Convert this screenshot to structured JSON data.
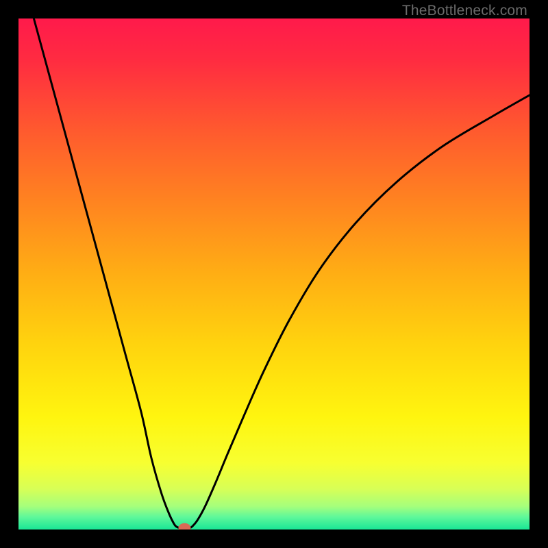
{
  "watermark": "TheBottleneck.com",
  "chart_data": {
    "type": "line",
    "title": "",
    "xlabel": "",
    "ylabel": "",
    "xlim": [
      0,
      100
    ],
    "ylim": [
      0,
      100
    ],
    "grid": false,
    "legend": false,
    "gradient_stops": [
      {
        "pos": 0.0,
        "color": "#ff1a4b"
      },
      {
        "pos": 0.08,
        "color": "#ff2b41"
      },
      {
        "pos": 0.22,
        "color": "#ff5a2e"
      },
      {
        "pos": 0.36,
        "color": "#ff8420"
      },
      {
        "pos": 0.5,
        "color": "#ffae14"
      },
      {
        "pos": 0.64,
        "color": "#ffd40e"
      },
      {
        "pos": 0.78,
        "color": "#fff50f"
      },
      {
        "pos": 0.87,
        "color": "#f7ff31"
      },
      {
        "pos": 0.92,
        "color": "#d8ff56"
      },
      {
        "pos": 0.955,
        "color": "#a5ff7c"
      },
      {
        "pos": 0.975,
        "color": "#60f89a"
      },
      {
        "pos": 1.0,
        "color": "#19e796"
      }
    ],
    "series": [
      {
        "name": "left-branch",
        "x": [
          3,
          6,
          9,
          12,
          15,
          18,
          21,
          24,
          26,
          28,
          29.5,
          30.5,
          31,
          31.5
        ],
        "y": [
          100,
          89,
          78,
          67,
          56,
          45,
          34,
          23,
          14,
          7,
          3,
          1,
          0.5,
          0.3
        ]
      },
      {
        "name": "right-branch",
        "x": [
          33.5,
          34,
          35,
          36.5,
          38.5,
          41,
          44,
          48,
          53,
          59,
          66,
          74,
          83,
          93,
          100
        ],
        "y": [
          0.3,
          0.6,
          1.8,
          4.5,
          9,
          15,
          22,
          31,
          41,
          51,
          60,
          68,
          75,
          81,
          85
        ]
      }
    ],
    "optimum_marker": {
      "x": 32.5,
      "y": 0.3,
      "color": "#d96a56"
    },
    "flat_segment": {
      "x_start": 31.5,
      "x_end": 33.5,
      "y": 0.3
    }
  }
}
